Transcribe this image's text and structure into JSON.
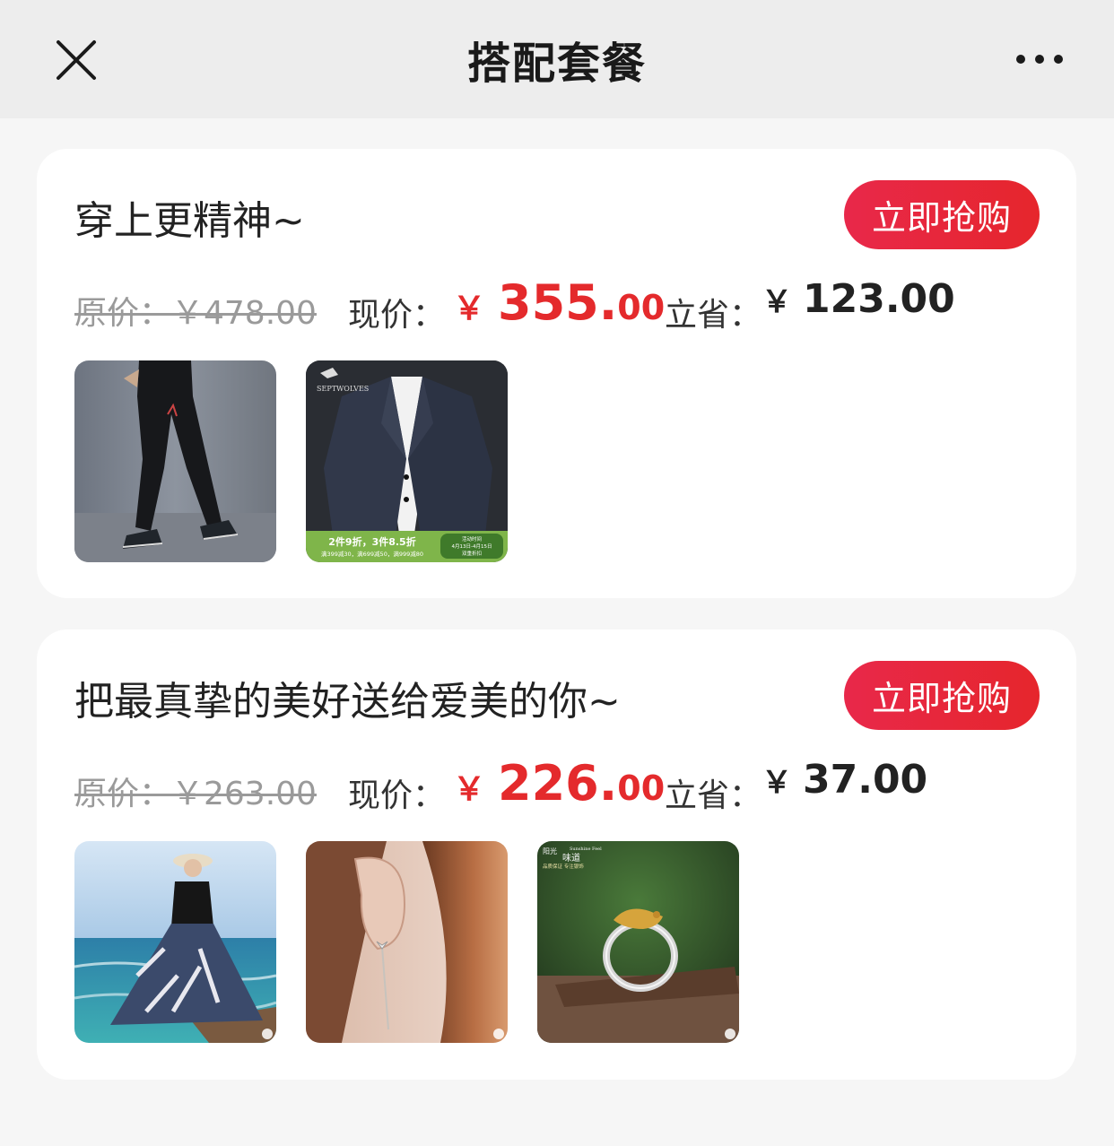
{
  "nav": {
    "title": "搭配套餐",
    "close_icon": "close-icon",
    "more_icon": "more-dots-icon"
  },
  "packages": [
    {
      "title": "穿上更精神~",
      "buy_label": "立即抢购",
      "original": "原价：￥478.00",
      "now_label": "现价：",
      "now_yen": "￥",
      "now_int": "355.",
      "now_dec": "00",
      "save_label": "立省：",
      "save_yen": "￥",
      "save_amount": "123.00",
      "banner_main": "2件9折，3件8.5折",
      "banner_sub": "满399减30，满699减50，满999减80",
      "banner_side_1": "活动时间",
      "banner_side_2": "4月13日-4月15日",
      "banner_side_3": "双重折扣",
      "brand": "SEPTWOLVES"
    },
    {
      "title": "把最真挚的美好送给爱美的你~",
      "buy_label": "立即抢购",
      "original": "原价：￥263.00",
      "now_label": "现价：",
      "now_yen": "￥",
      "now_int": "226.",
      "now_dec": "00",
      "save_label": "立省：",
      "save_yen": "￥",
      "save_amount": "37.00",
      "ring_brand_1": "阳光",
      "ring_brand_2": "味道",
      "ring_brand_en": "Sunshine Feel",
      "ring_tagline": "品质保证 专注银饰"
    }
  ],
  "colors": {
    "accent": "#e42a2c",
    "button": "#e8284a",
    "nav_bg": "#ededed",
    "page_bg": "#f6f6f6"
  }
}
